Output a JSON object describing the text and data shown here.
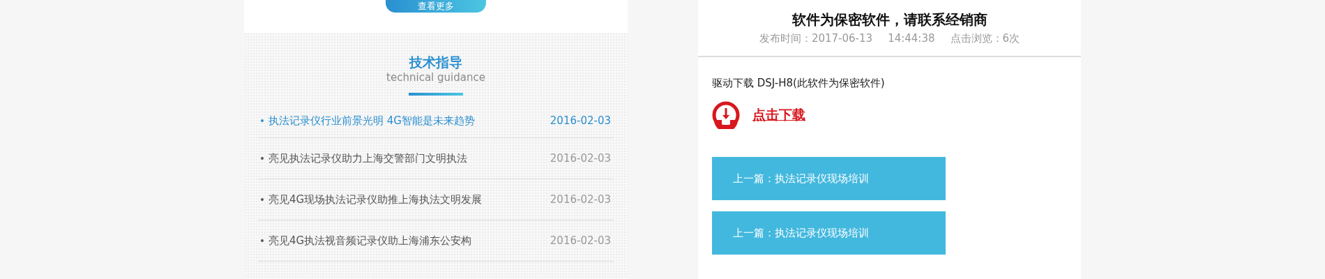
{
  "more_button": {
    "label": "查看更多"
  },
  "guidance": {
    "title": "技术指导",
    "subtitle": "technical guidance",
    "articles": [
      {
        "title": "执法记录仪行业前景光明 4G智能是未来趋势",
        "date": "2016-02-03",
        "selected": true
      },
      {
        "title": "亮见执法记录仪助力上海交警部门文明执法",
        "date": "2016-02-03",
        "selected": false
      },
      {
        "title": "亮见4G现场执法记录仪助推上海执法文明发展",
        "date": "2016-02-03",
        "selected": false
      },
      {
        "title": "亮见4G执法视音频记录仪助上海浦东公安构",
        "date": "2016-02-03",
        "selected": false
      }
    ]
  },
  "article": {
    "title": "软件为保密软件，请联系经销商",
    "meta": [
      "发布时间：2017-06-13",
      "14:44:38",
      "点击浏览：6次"
    ],
    "body": "驱动下载 DSJ-H8(此软件为保密软件)",
    "download_link": "点击下载",
    "nav": [
      {
        "label": "上一篇：执法记录仪现场培训"
      },
      {
        "label": "上一篇：执法记录仪现场培训"
      }
    ]
  }
}
